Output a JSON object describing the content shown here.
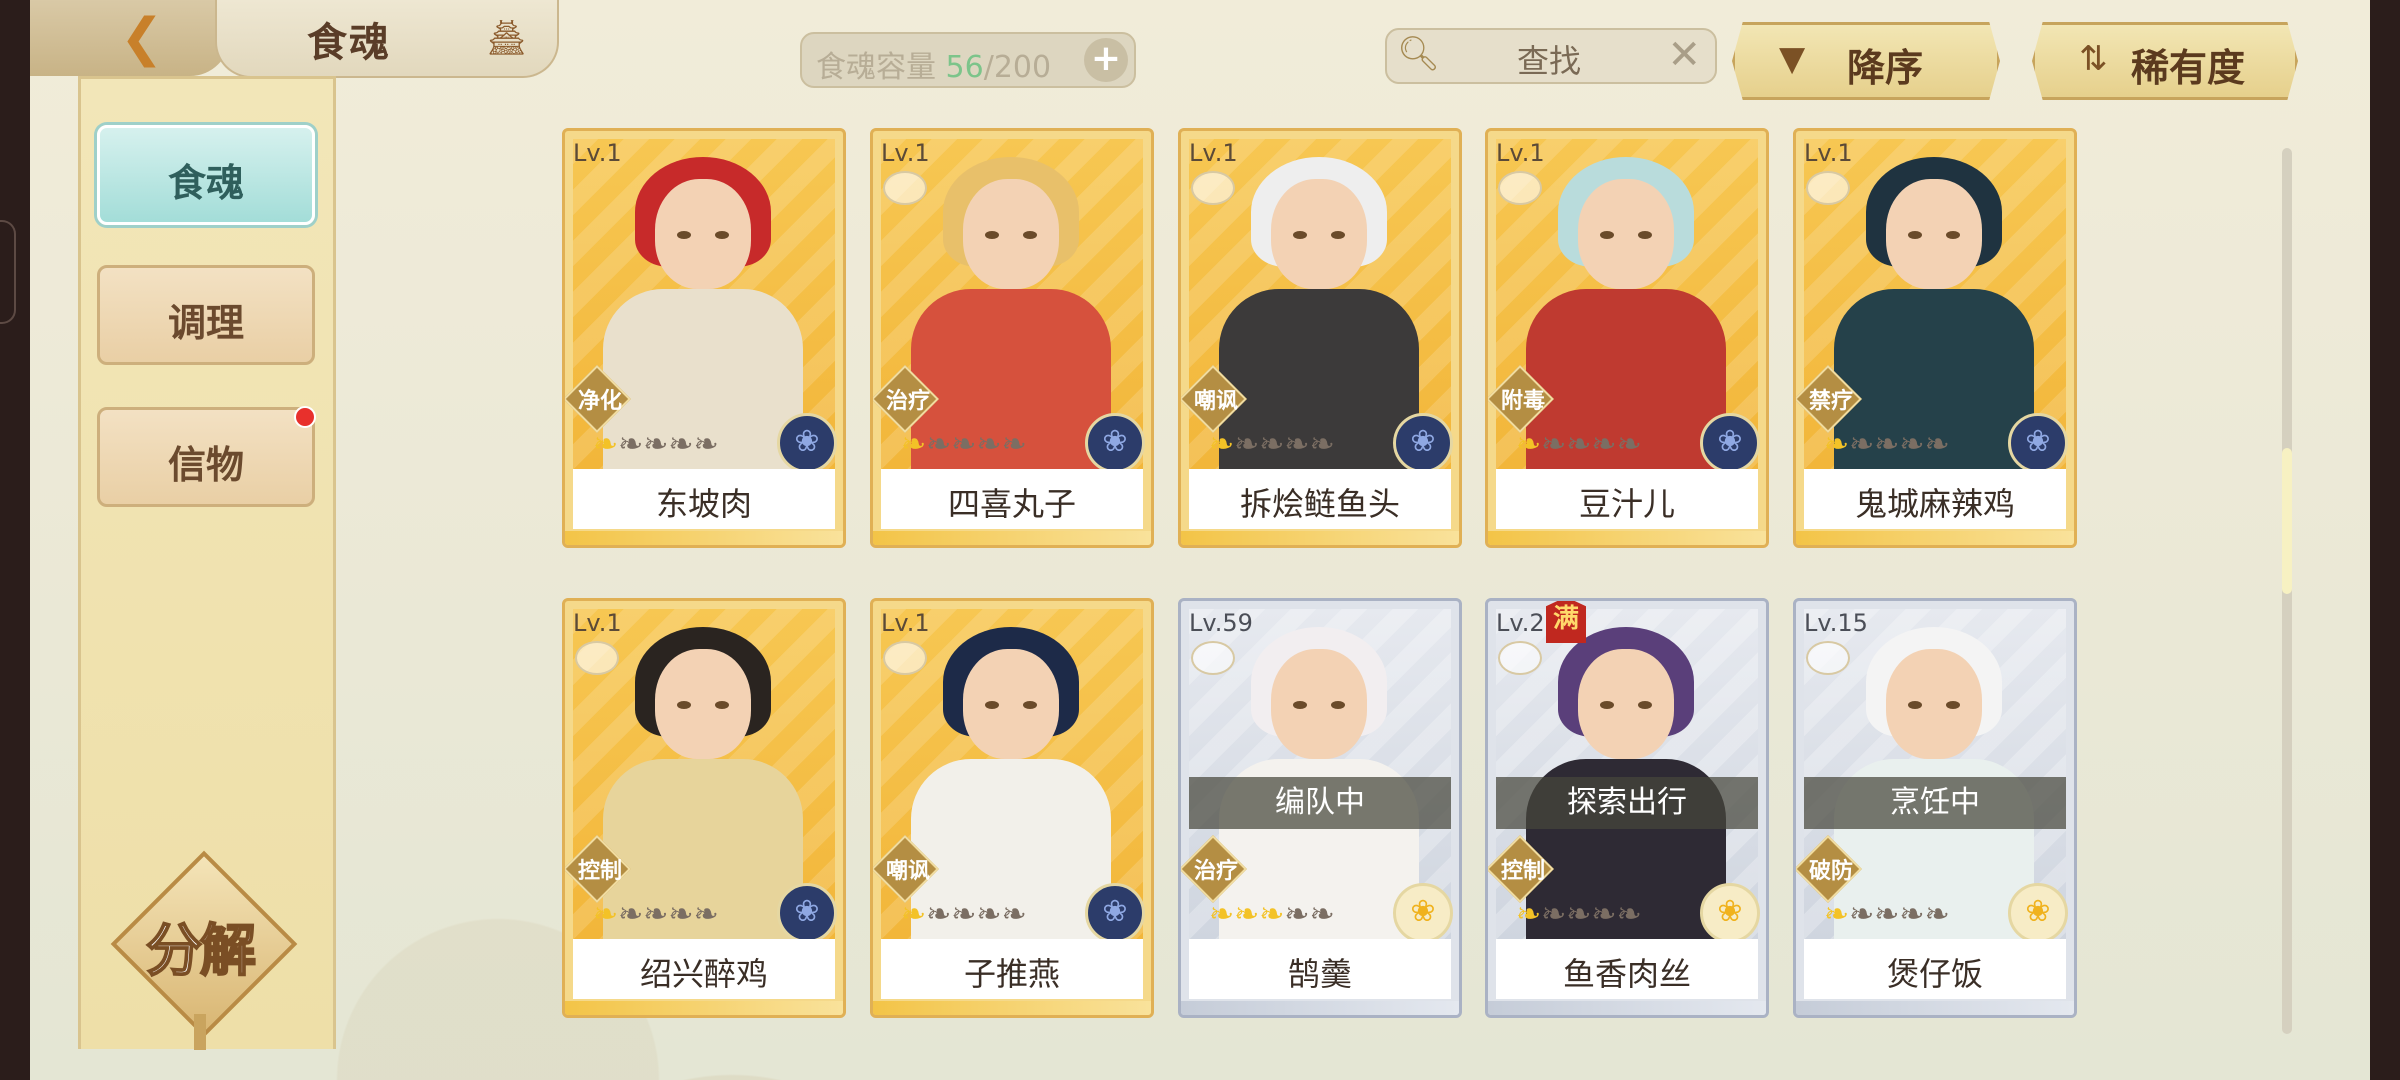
{
  "header": {
    "back_icon": "back-arrow-icon",
    "title": "食魂",
    "pagoda_icon": "pagoda-icon",
    "capacity_label": "食魂容量",
    "capacity_current": "56",
    "capacity_total": "/200",
    "add_icon": "+",
    "search_placeholder": "查找",
    "clear_icon": "✕",
    "sort_label": "降序",
    "rarity_label": "稀有度"
  },
  "sidebar": {
    "items": [
      {
        "label": "食魂",
        "active": true
      },
      {
        "label": "调理",
        "active": false
      },
      {
        "label": "信物",
        "active": false,
        "notification": true
      }
    ],
    "decompose_label": "分解"
  },
  "cards": [
    {
      "level": "Lv.1",
      "name": "东坡肉",
      "role": "净化",
      "stars": 1,
      "rarity": "gold",
      "status": "",
      "hair": "#c72a2a",
      "body": "#e9e0cc"
    },
    {
      "level": "Lv.1",
      "name": "四喜丸子",
      "role": "治疗",
      "stars": 1,
      "rarity": "gold",
      "status": "",
      "hair": "#e8c06a",
      "body": "#d6513d"
    },
    {
      "level": "Lv.1",
      "name": "拆烩鲢鱼头",
      "role": "嘲讽",
      "stars": 1,
      "rarity": "gold",
      "status": "",
      "hair": "#eeeeee",
      "body": "#3c3a3a"
    },
    {
      "level": "Lv.1",
      "name": "豆汁儿",
      "role": "附毒",
      "stars": 1,
      "rarity": "gold",
      "status": "",
      "hair": "#b9dcdc",
      "body": "#bf3a30"
    },
    {
      "level": "Lv.1",
      "name": "鬼城麻辣鸡",
      "role": "禁疗",
      "stars": 1,
      "rarity": "gold",
      "status": "",
      "hair": "#1f3340",
      "body": "#25414a"
    },
    {
      "level": "Lv.1",
      "name": "绍兴醉鸡",
      "role": "控制",
      "stars": 1,
      "rarity": "gold",
      "status": "",
      "hair": "#2a2420",
      "body": "#e7d49b"
    },
    {
      "level": "Lv.1",
      "name": "子推燕",
      "role": "嘲讽",
      "stars": 1,
      "rarity": "gold",
      "status": "",
      "hair": "#1d2a48",
      "body": "#f2f0ea"
    },
    {
      "level": "Lv.59",
      "name": "鹄羹",
      "role": "治疗",
      "stars": 3,
      "rarity": "silver",
      "status": "编队中",
      "hair": "#f2eef0",
      "body": "#f4f2ee"
    },
    {
      "level": "Lv.20",
      "name": "鱼香肉丝",
      "role": "控制",
      "stars": 1,
      "rarity": "silver",
      "status": "探索出行",
      "hair": "#5a3f7a",
      "body": "#2e2a34",
      "max": "满"
    },
    {
      "level": "Lv.15",
      "name": "煲仔饭",
      "role": "破防",
      "stars": 1,
      "rarity": "silver",
      "status": "烹饪中",
      "hair": "#f4f4f4",
      "body": "#e9f0ee"
    }
  ],
  "colors": {
    "capacity_current": "#7cc48a",
    "accent_gold": "#e0b055",
    "active_tab": "#a3ddd8"
  }
}
